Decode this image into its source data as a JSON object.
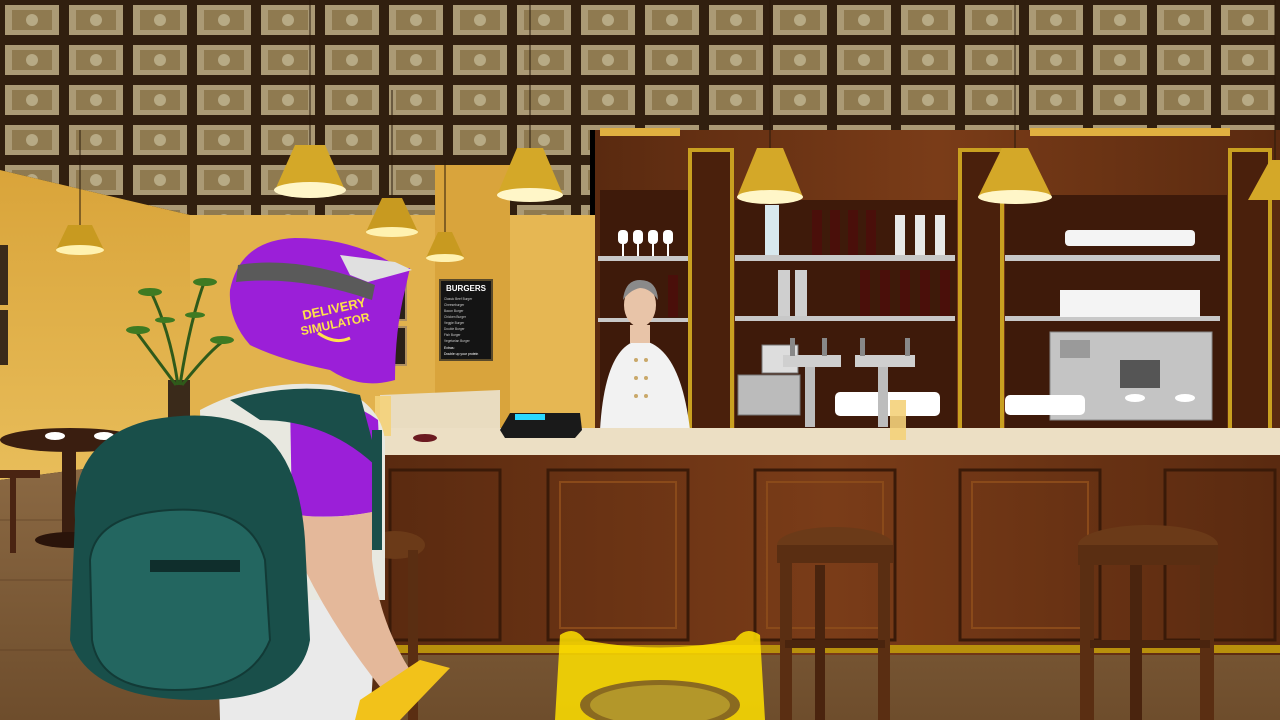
{
  "scene": {
    "location": "burger bar interior",
    "view": "third-person"
  },
  "menu_board": {
    "title": "BURGERS",
    "items": [
      "Classic Beef Burger",
      "Cheeseburger",
      "Bacon Burger",
      "Chicken Burger",
      "Veggie Burger",
      "Double Burger",
      "Fish Burger",
      "Vegetarian Burger"
    ],
    "footer_1": "Extras:",
    "footer_2": "Double up your protein"
  },
  "player": {
    "helmet_text_line1": "DELIVERY",
    "helmet_text_line2": "SIMULATOR"
  },
  "colors": {
    "helmet": "#9b1fd8",
    "wall": "#e3b24a",
    "bar_wood": "#6b3414",
    "backpack": "#1d5a55",
    "marker": "#ffe000"
  }
}
